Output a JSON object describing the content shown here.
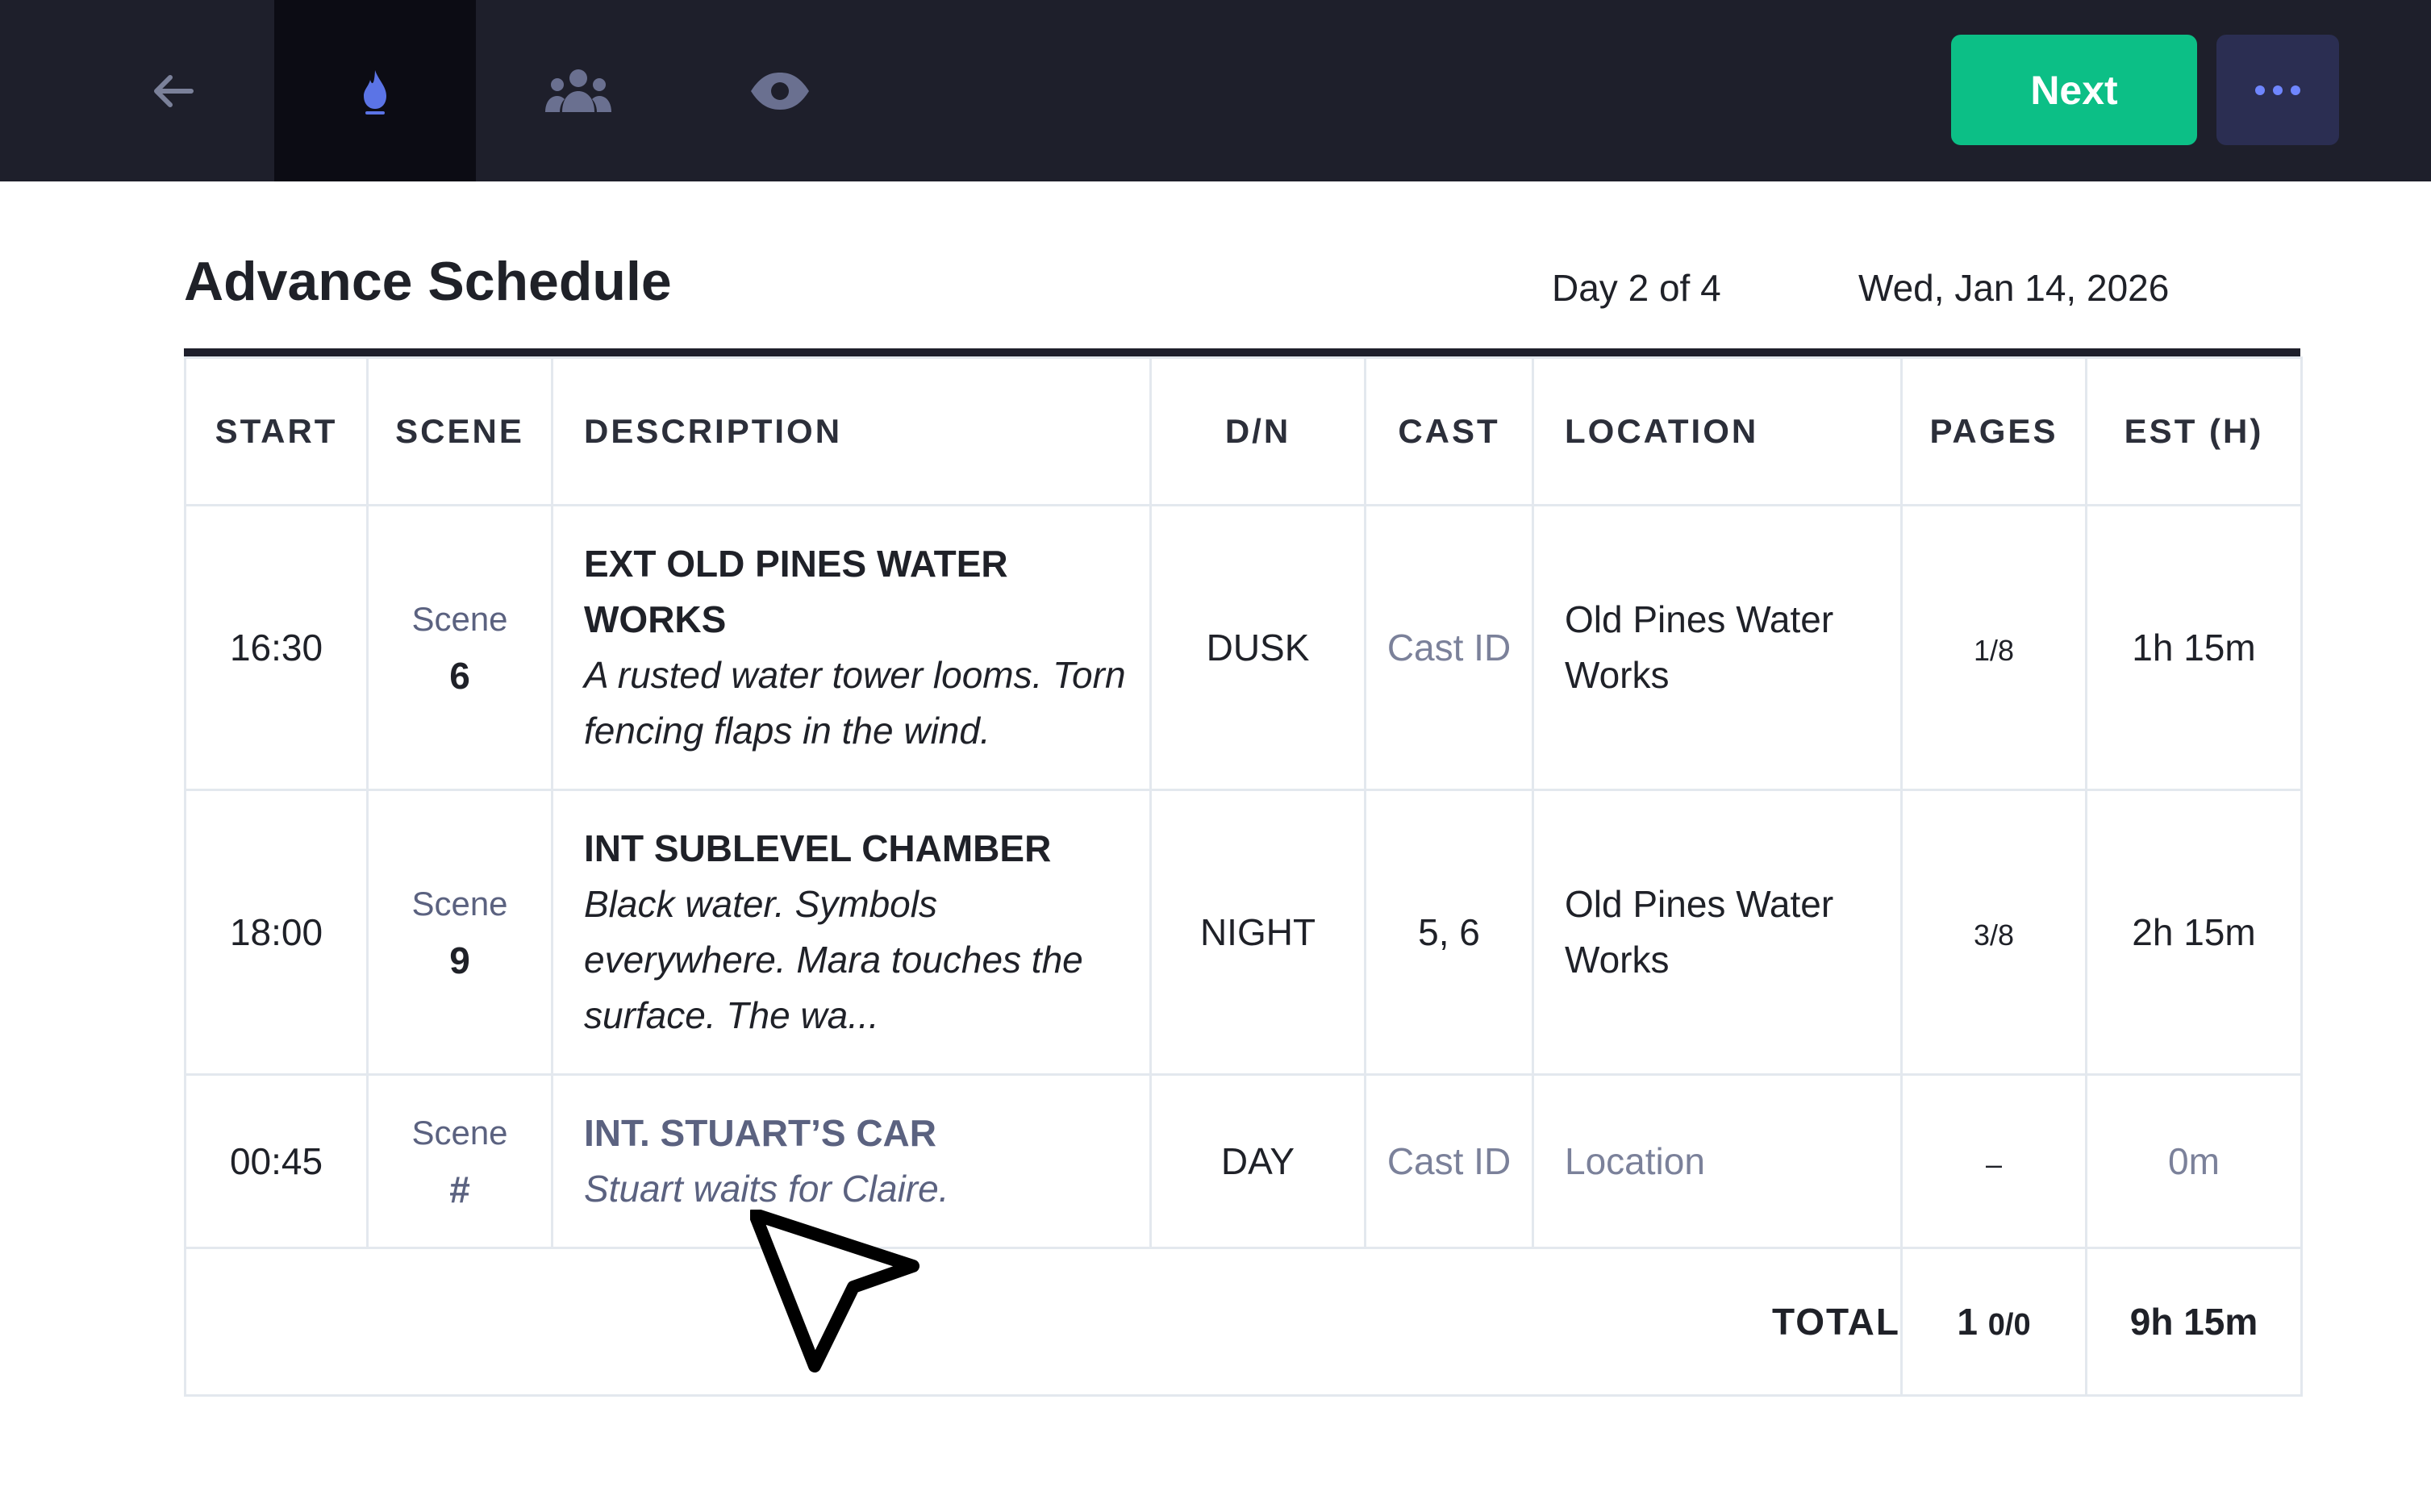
{
  "topbar": {
    "nav": [
      {
        "icon": "arrow-left-icon"
      },
      {
        "icon": "flame-icon",
        "active": true
      },
      {
        "icon": "users-icon"
      },
      {
        "icon": "eye-icon"
      }
    ],
    "next_label": "Next",
    "more_icon": "ellipsis-icon"
  },
  "header": {
    "title": "Advance Schedule",
    "day": "Day 2 of 4",
    "date": "Wed, Jan 14, 2026"
  },
  "table": {
    "columns": [
      "START",
      "SCENE",
      "DESCRIPTION",
      "D/N",
      "CAST",
      "LOCATION",
      "PAGES",
      "EST (H)"
    ],
    "rows": [
      {
        "start": "16:30",
        "scene_label": "Scene",
        "scene_num": "6",
        "desc_title": "EXT OLD PINES WATER WORKS",
        "desc_text": "A rusted water tower looms. Torn fencing flaps in the wind.",
        "dn": "DUSK",
        "cast": "Cast ID",
        "location": "Old Pines Water Works",
        "pages": "1/8",
        "est": "1h 15m"
      },
      {
        "start": "18:00",
        "scene_label": "Scene",
        "scene_num": "9",
        "desc_title": "INT SUBLEVEL CHAMBER",
        "desc_text": "Black water. Symbols everywhere. Mara touches the surface. The wa...",
        "dn": "NIGHT",
        "cast": "5, 6",
        "location": "Old Pines Water Works",
        "pages": "3/8",
        "est": "2h 15m"
      },
      {
        "start": "00:45",
        "scene_label": "Scene",
        "scene_num": "#",
        "desc_title": "INT. STUART’S CAR",
        "desc_text": "Stuart waits for Claire.",
        "dn": "DAY",
        "cast": "Cast ID",
        "location": "Location",
        "pages": "–",
        "est": "0m"
      }
    ],
    "total": {
      "label": "TOTAL",
      "pages_whole": "1",
      "pages_frac": "0/0",
      "est": "9h 15m"
    }
  },
  "colors": {
    "topbar_bg": "#1e1f2b",
    "active_tab_bg": "#0c0c14",
    "next_button": "#0cbf86",
    "more_button": "#2b2e52",
    "accent_icon": "#5b74e6",
    "muted_text": "#7b819a"
  }
}
